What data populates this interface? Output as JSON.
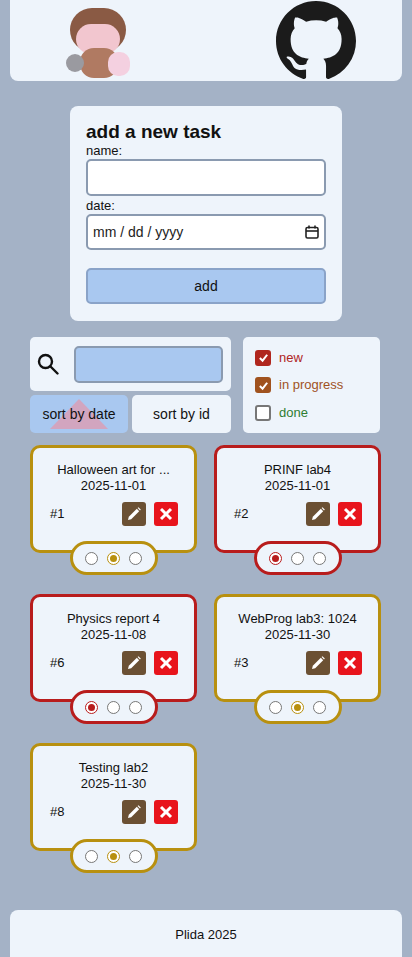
{
  "form": {
    "title": "add a new task",
    "name_label": "name:",
    "date_label": "date:",
    "date_placeholder": "mm / dd / yyyy",
    "button": "add"
  },
  "sort": {
    "ascending": true,
    "buttons": [
      {
        "label": "sort by date",
        "selected": true
      },
      {
        "label": "sort by id",
        "selected": false
      }
    ]
  },
  "filters": [
    {
      "label": "new",
      "checked": true,
      "color": "#b0261e"
    },
    {
      "label": "in progress",
      "checked": true,
      "color": "#a0521e"
    },
    {
      "label": "done",
      "checked": false,
      "color": "#2e7d32"
    }
  ],
  "tasks": [
    {
      "name": "Halloween art for ...",
      "date": "2025-11-01",
      "id": "#1",
      "color": "#b8900f",
      "status_radios": [
        {
          "selected": false
        },
        {
          "selected": true
        },
        {
          "selected": false
        }
      ]
    },
    {
      "name": "PRINF lab4",
      "date": "2025-11-01",
      "id": "#2",
      "color": "#b81c1c",
      "status_radios": [
        {
          "selected": true
        },
        {
          "selected": false
        },
        {
          "selected": false
        }
      ]
    },
    {
      "name": "Physics report 4",
      "date": "2025-11-08",
      "id": "#6",
      "color": "#b81c1c",
      "status_radios": [
        {
          "selected": true
        },
        {
          "selected": false
        },
        {
          "selected": false
        }
      ]
    },
    {
      "name": "WebProg lab3: 1024",
      "date": "2025-11-30",
      "id": "#3",
      "color": "#b8900f",
      "status_radios": [
        {
          "selected": false
        },
        {
          "selected": true
        },
        {
          "selected": false
        }
      ]
    },
    {
      "name": "Testing lab2",
      "date": "2025-11-30",
      "id": "#8",
      "color": "#b8900f",
      "status_radios": [
        {
          "selected": false
        },
        {
          "selected": true
        },
        {
          "selected": false
        }
      ]
    }
  ],
  "footer": "Plida 2025"
}
